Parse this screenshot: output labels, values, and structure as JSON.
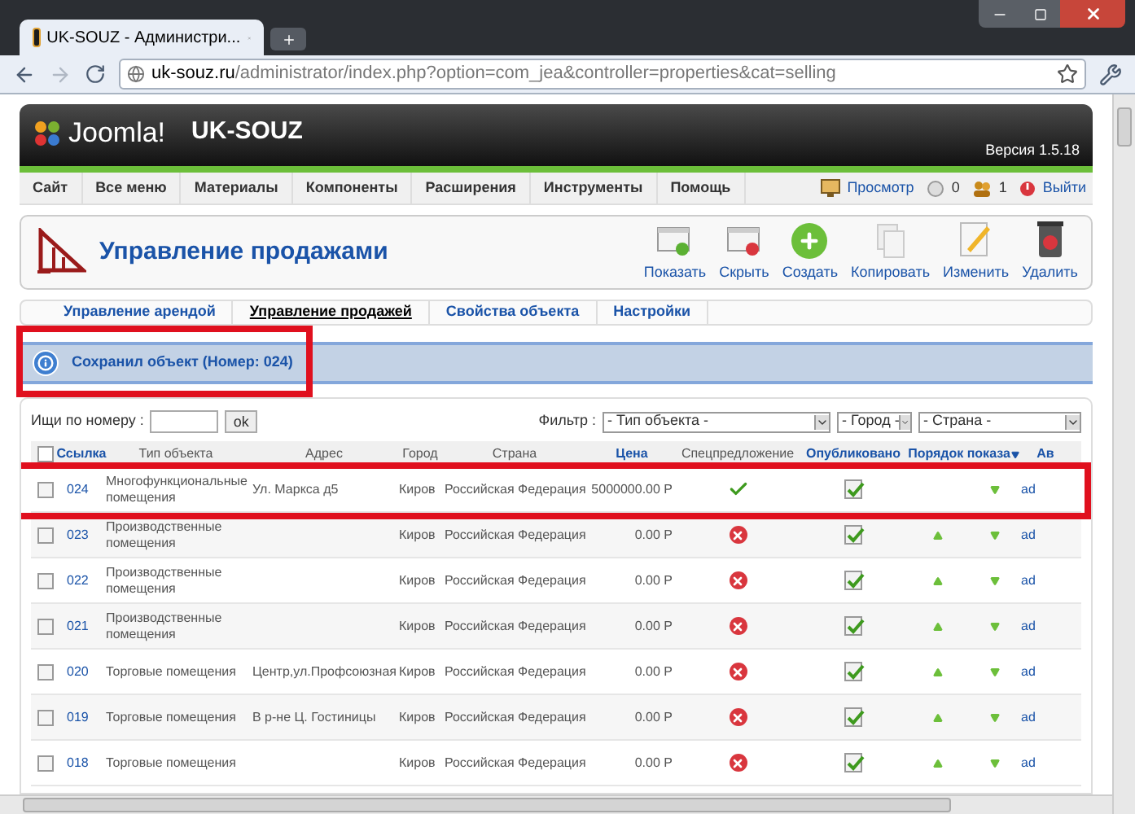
{
  "browser": {
    "tab_title": "UK-SOUZ - Администри...",
    "url_host": "uk-souz.ru",
    "url_path": "/administrator/index.php?option=com_jea&controller=properties&cat=selling"
  },
  "header": {
    "logo": "Joomla!",
    "site": "UK-SOUZ",
    "version": "Версия 1.5.18"
  },
  "menu": [
    "Сайт",
    "Все меню",
    "Материалы",
    "Компоненты",
    "Расширения",
    "Инструменты",
    "Помощь"
  ],
  "status": [
    {
      "kind": "preview",
      "label": "Просмотр"
    },
    {
      "kind": "messages",
      "label": "0"
    },
    {
      "kind": "users",
      "label": "1"
    },
    {
      "kind": "logout",
      "label": "Выйти"
    }
  ],
  "page_title": "Управление продажами",
  "toolbar": [
    {
      "kind": "publish",
      "label": "Показать"
    },
    {
      "kind": "unpublish",
      "label": "Скрыть"
    },
    {
      "kind": "new",
      "label": "Создать"
    },
    {
      "kind": "copy",
      "label": "Копировать"
    },
    {
      "kind": "edit",
      "label": "Изменить"
    },
    {
      "kind": "delete",
      "label": "Удалить"
    }
  ],
  "submenu": [
    {
      "label": "Управление арендой",
      "selected": false
    },
    {
      "label": "Управление продажей",
      "selected": true
    },
    {
      "label": "Свойства объекта",
      "selected": false
    },
    {
      "label": "Настройки",
      "selected": false
    }
  ],
  "message": {
    "text": "Сохранил объект (Номер: 024)",
    "highlighted": true
  },
  "search": {
    "label": "Ищи по номеру :",
    "button": "ok"
  },
  "filter": {
    "label": "Фильтр :",
    "selects": [
      "- Тип объекта -",
      "- Город -",
      "- Страна -"
    ]
  },
  "table": {
    "select_all_checked": false,
    "columns": [
      {
        "label": "Ссылка",
        "link": true
      },
      {
        "label": "Тип объекта",
        "link": false
      },
      {
        "label": "Адрес",
        "link": false
      },
      {
        "label": "Город",
        "link": false
      },
      {
        "label": "Страна",
        "link": false
      },
      {
        "label": "Цена",
        "link": true
      },
      {
        "label": "Спецпредложение",
        "link": false
      },
      {
        "label": "Опубликовано",
        "link": true
      },
      {
        "label": "Порядок показа",
        "link": true
      },
      {
        "label": "Ав",
        "link": true
      }
    ],
    "rows": [
      {
        "checked": false,
        "id": "024",
        "type": "Многофункциональные помещения",
        "address": "Ул. Маркса д5",
        "city": "Киров",
        "country": "Российская Федерация",
        "price": "5000000.00 Р",
        "special": true,
        "published": true,
        "up": false,
        "down": true,
        "author": "ad",
        "highlighted": true
      },
      {
        "checked": false,
        "id": "023",
        "type": "Производственные помещения",
        "address": "",
        "city": "Киров",
        "country": "Российская Федерация",
        "price": "0.00 Р",
        "special": false,
        "published": true,
        "up": true,
        "down": true,
        "author": "ad",
        "highlighted": false
      },
      {
        "checked": false,
        "id": "022",
        "type": "Производственные помещения",
        "address": "",
        "city": "Киров",
        "country": "Российская Федерация",
        "price": "0.00 Р",
        "special": false,
        "published": true,
        "up": true,
        "down": true,
        "author": "ad",
        "highlighted": false
      },
      {
        "checked": false,
        "id": "021",
        "type": "Производственные помещения",
        "address": "",
        "city": "Киров",
        "country": "Российская Федерация",
        "price": "0.00 Р",
        "special": false,
        "published": true,
        "up": true,
        "down": true,
        "author": "ad",
        "highlighted": false
      },
      {
        "checked": false,
        "id": "020",
        "type": "Торговые помещения",
        "address": "Центр,ул.Профсоюзная",
        "city": "Киров",
        "country": "Российская Федерация",
        "price": "0.00 Р",
        "special": false,
        "published": true,
        "up": true,
        "down": true,
        "author": "ad",
        "highlighted": false
      },
      {
        "checked": false,
        "id": "019",
        "type": "Торговые помещения",
        "address": "В р-не Ц. Гостиницы",
        "city": "Киров",
        "country": "Российская Федерация",
        "price": "0.00 Р",
        "special": false,
        "published": true,
        "up": true,
        "down": true,
        "author": "ad",
        "highlighted": false
      },
      {
        "checked": false,
        "id": "018",
        "type": "Торговые помещения",
        "address": "",
        "city": "Киров",
        "country": "Российская Федерация",
        "price": "0.00 Р",
        "special": false,
        "published": true,
        "up": true,
        "down": true,
        "author": "ad",
        "highlighted": false
      }
    ]
  }
}
